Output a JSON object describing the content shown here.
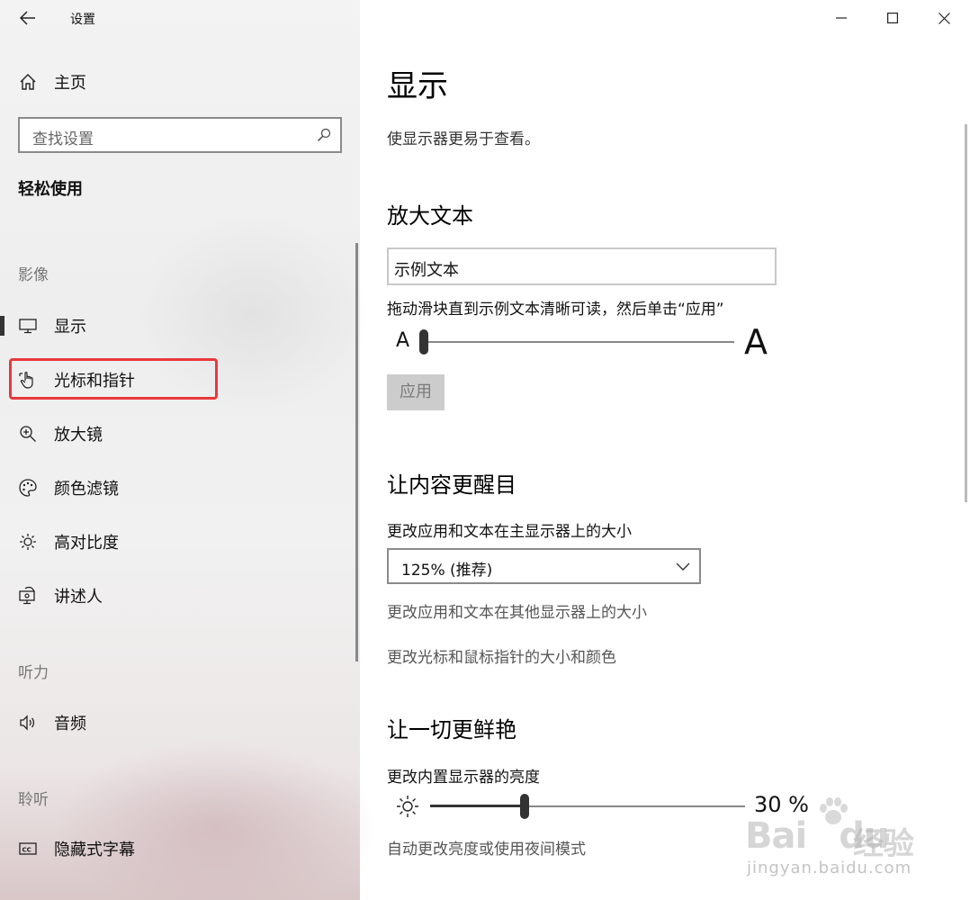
{
  "window": {
    "title": "设置",
    "back_icon": "arrow-left-icon",
    "controls": [
      "minimize-icon",
      "maximize-icon",
      "close-icon"
    ]
  },
  "sidebar": {
    "home_label": "主页",
    "search_placeholder": "查找设置",
    "section_title": "轻松使用",
    "groups": {
      "vision": "影像",
      "hearing": "听力",
      "interaction": "聆听"
    },
    "items": [
      {
        "label": "显示",
        "icon": "monitor-icon",
        "selected": true
      },
      {
        "label": "光标和指针",
        "icon": "hand-pointer-icon",
        "selected": false,
        "highlighted": true
      },
      {
        "label": "放大镜",
        "icon": "magnifier-zoom-icon",
        "selected": false
      },
      {
        "label": "颜色滤镜",
        "icon": "color-palette-icon",
        "selected": false
      },
      {
        "label": "高对比度",
        "icon": "contrast-sun-icon",
        "selected": false
      },
      {
        "label": "讲述人",
        "icon": "narrator-icon",
        "selected": false
      },
      {
        "label": "音频",
        "icon": "speaker-icon",
        "selected": false
      },
      {
        "label": "隐藏式字幕",
        "icon": "closed-caption-icon",
        "selected": false
      }
    ],
    "highlight_color": "#e8383d"
  },
  "main": {
    "title": "显示",
    "description": "使显示器更易于查看。",
    "enlarge_text": {
      "heading": "放大文本",
      "sample_text": "示例文本",
      "hint": "拖动滑块直到示例文本清晰可读，然后单击“应用”",
      "small_a": "A",
      "big_a": "A",
      "slider_value_fraction": 0.0,
      "apply_label": "应用"
    },
    "make_prominent": {
      "heading": "让内容更醒目",
      "scale_label": "更改应用和文本在主显示器上的大小",
      "scale_value": "125% (推荐)",
      "other_displays_link": "更改应用和文本在其他显示器上的大小",
      "cursor_link": "更改光标和鼠标指针的大小和颜色"
    },
    "brighter": {
      "heading": "让一切更鲜艳",
      "brightness_label": "更改内置显示器的亮度",
      "brightness_value": "30 %",
      "brightness_percent": 30,
      "auto_link": "自动更改亮度或使用夜间模式"
    }
  },
  "watermark": {
    "logo": "Bai",
    "logo_tail": "du",
    "cn": "经验",
    "url": "jingyan.baidu.com"
  }
}
